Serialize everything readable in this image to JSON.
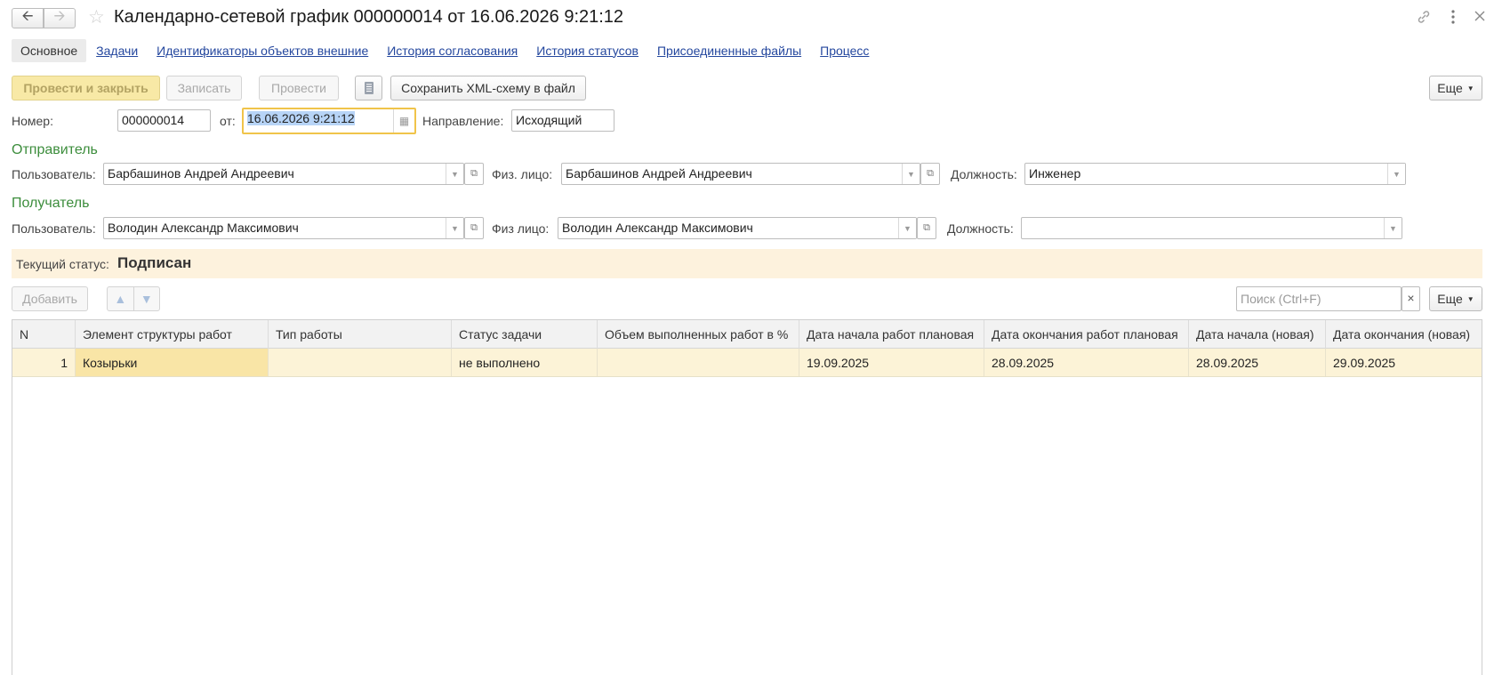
{
  "window": {
    "title": "Календарно-сетевой график 000000014 от 16.06.2026 9:21:12"
  },
  "tabs": [
    {
      "label": "Основное"
    },
    {
      "label": "Задачи"
    },
    {
      "label": "Идентификаторы объектов внешние"
    },
    {
      "label": "История согласования"
    },
    {
      "label": "История статусов"
    },
    {
      "label": "Присоединенные файлы"
    },
    {
      "label": "Процесс"
    }
  ],
  "toolbar": {
    "post_close": "Провести и закрыть",
    "save": "Записать",
    "post": "Провести",
    "save_xml": "Сохранить XML-схему в файл",
    "more": "Еще"
  },
  "header": {
    "number_label": "Номер:",
    "number_value": "000000014",
    "date_label": "от:",
    "date_value": "16.06.2026  9:21:12",
    "direction_label": "Направление:",
    "direction_value": "Исходящий"
  },
  "sender": {
    "section_title": "Отправитель",
    "user_label": "Пользователь:",
    "user_value": "Барбашинов Андрей Андреевич",
    "person_label": "Физ. лицо:",
    "person_value": "Барбашинов Андрей Андреевич",
    "position_label": "Должность:",
    "position_value": "Инженер"
  },
  "recipient": {
    "section_title": "Получатель",
    "user_label": "Пользователь:",
    "user_value": "Володин Александр Максимович",
    "person_label": "Физ лицо:",
    "person_value": "Володин Александр Максимович",
    "position_label": "Должность:",
    "position_value": ""
  },
  "status": {
    "label": "Текущий статус:",
    "value": "Подписан"
  },
  "table_toolbar": {
    "add": "Добавить",
    "search_placeholder": "Поиск (Ctrl+F)",
    "clear": "×",
    "more": "Еще"
  },
  "table": {
    "columns": [
      "N",
      "Элемент структуры работ",
      "Тип работы",
      "Статус задачи",
      "Объем выполненных работ в %",
      "Дата начала работ плановая",
      "Дата окончания работ плановая",
      "Дата начала (новая)",
      "Дата окончания (новая)"
    ],
    "rows": [
      [
        "1",
        "Козырьки",
        "",
        "не выполнено",
        "",
        "19.09.2025",
        "28.09.2025",
        "28.09.2025",
        "29.09.2025"
      ]
    ]
  },
  "colors": {
    "accent_yellow": "#f8e9a6",
    "section_green": "#3c8d3c",
    "link_blue": "#24479e",
    "status_bg": "#fdf2dd",
    "row_selected": "#fcf3d7"
  },
  "icons": [
    "back-arrow-icon",
    "forward-arrow-icon",
    "star-icon",
    "link-icon",
    "more-vertical-icon",
    "close-icon",
    "calendar-icon",
    "document-icon",
    "arrow-up-icon",
    "arrow-down-icon",
    "open-icon",
    "dropdown-icon"
  ]
}
